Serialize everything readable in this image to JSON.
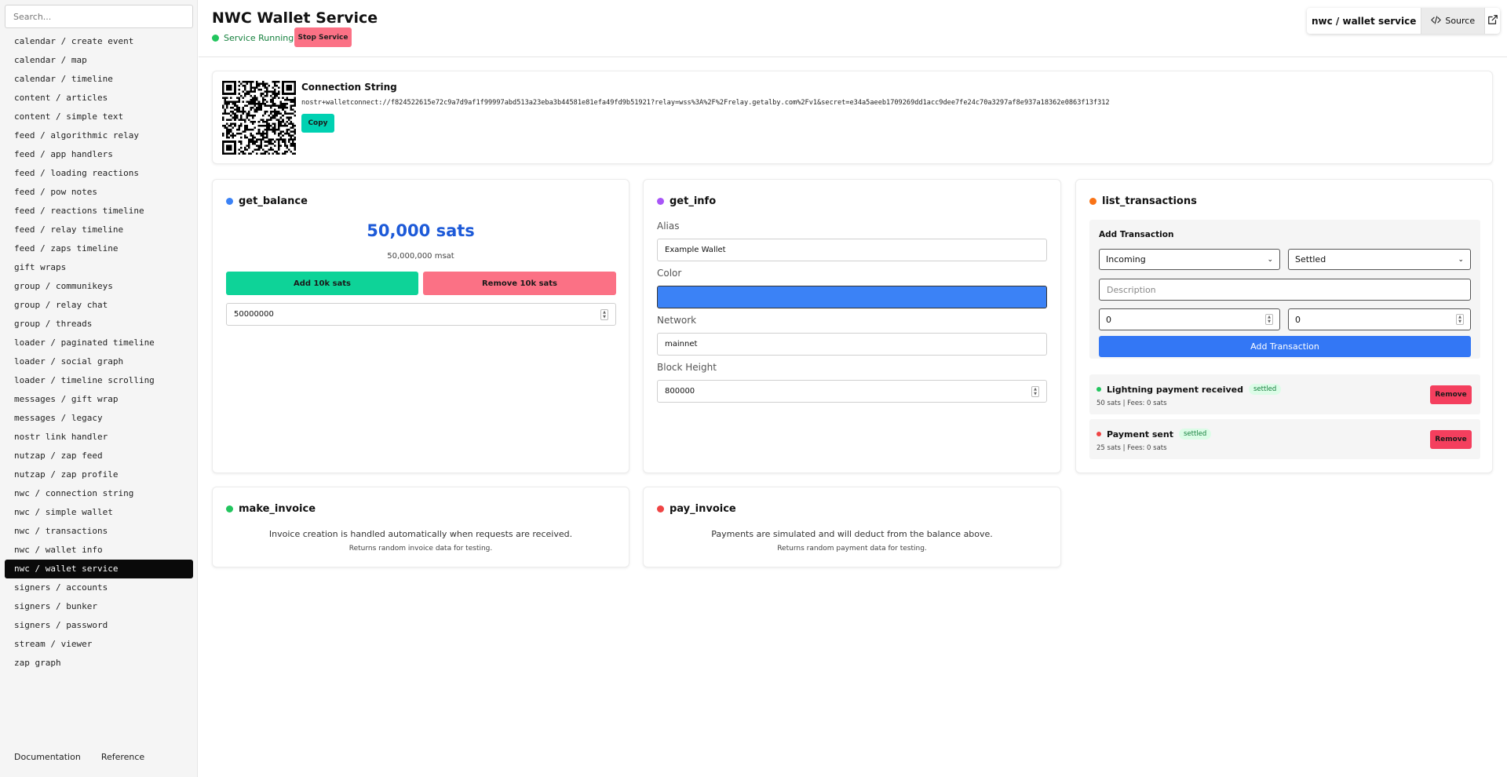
{
  "sidebar": {
    "search_placeholder": "Search...",
    "items": [
      "calendar / create event",
      "calendar / map",
      "calendar / timeline",
      "content / articles",
      "content / simple text",
      "feed / algorithmic relay",
      "feed / app handlers",
      "feed / loading reactions",
      "feed / pow notes",
      "feed / reactions timeline",
      "feed / relay timeline",
      "feed / zaps timeline",
      "gift wraps",
      "group / communikeys",
      "group / relay chat",
      "group / threads",
      "loader / paginated timeline",
      "loader / social graph",
      "loader / timeline scrolling",
      "messages / gift wrap",
      "messages / legacy",
      "nostr link handler",
      "nutzap / zap feed",
      "nutzap / zap profile",
      "nwc / connection string",
      "nwc / simple wallet",
      "nwc / transactions",
      "nwc / wallet info",
      "nwc / wallet service",
      "signers / accounts",
      "signers / bunker",
      "signers / password",
      "stream / viewer",
      "zap graph"
    ],
    "active_item": "nwc / wallet service",
    "footer": {
      "documentation": "Documentation",
      "reference": "Reference"
    }
  },
  "header": {
    "title": "NWC Wallet Service",
    "status": "Service Running",
    "stop_button": "Stop Service",
    "breadcrumb": "nwc / wallet service",
    "source_button": "Source"
  },
  "connection": {
    "title": "Connection String",
    "value": "nostr+walletconnect://f824522615e72c9a7d9af1f99997abd513a23eba3b44581e81efa49fd9b51921?relay=wss%3A%2F%2Frelay.getalby.com%2Fv1&secret=e34a5aeeb1709269dd1acc9dee7fe24c70a3297af8e937a18362e0863f13f312",
    "copy_button": "Copy"
  },
  "get_balance": {
    "title": "get_balance",
    "sats": "50,000 sats",
    "msat": "50,000,000 msat",
    "add_button": "Add 10k sats",
    "remove_button": "Remove 10k sats",
    "input_value": "50000000"
  },
  "get_info": {
    "title": "get_info",
    "alias_label": "Alias",
    "alias_value": "Example Wallet",
    "color_label": "Color",
    "color_value": "#3b82f6",
    "network_label": "Network",
    "network_value": "mainnet",
    "block_height_label": "Block Height",
    "block_height_value": "800000"
  },
  "list_transactions": {
    "title": "list_transactions",
    "add_title": "Add Transaction",
    "type_selected": "Incoming",
    "state_selected": "Settled",
    "description_placeholder": "Description",
    "amount_value": "0",
    "fees_value": "0",
    "add_button": "Add Transaction",
    "transactions": [
      {
        "title": "Lightning payment received",
        "badge": "settled",
        "meta": "50 sats | Fees: 0 sats",
        "remove": "Remove",
        "dot_color": "#22c55e"
      },
      {
        "title": "Payment sent",
        "badge": "settled",
        "meta": "25 sats | Fees: 0 sats",
        "remove": "Remove",
        "dot_color": "#ef4444"
      }
    ]
  },
  "make_invoice": {
    "title": "make_invoice",
    "description": "Invoice creation is handled automatically when requests are received.",
    "sub": "Returns random invoice data for testing."
  },
  "pay_invoice": {
    "title": "pay_invoice",
    "description": "Payments are simulated and will deduct from the balance above.",
    "sub": "Returns random payment data for testing."
  },
  "colors": {
    "status_green": "#22c55e",
    "balance_dot": "#3b82f6",
    "info_dot": "#a855f7",
    "list_dot": "#f97316",
    "make_dot": "#22c55e",
    "pay_dot": "#ef4444",
    "accent_blue": "#1d5ad8"
  },
  "icons": [
    "code-icon",
    "external-link-icon",
    "qr-code",
    "chevron-down-icon",
    "spinner-icon"
  ]
}
